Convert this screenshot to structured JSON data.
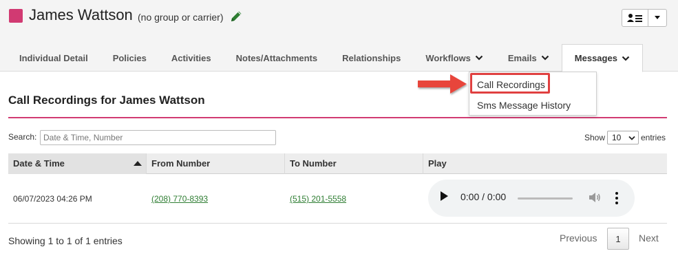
{
  "header": {
    "name": "James Wattson",
    "subtitle": "(no group or carrier)",
    "color_box": "#d13a72"
  },
  "tabs": [
    {
      "label": "Individual Detail",
      "dropdown": false
    },
    {
      "label": "Policies",
      "dropdown": false
    },
    {
      "label": "Activities",
      "dropdown": false
    },
    {
      "label": "Notes/Attachments",
      "dropdown": false
    },
    {
      "label": "Relationships",
      "dropdown": false
    },
    {
      "label": "Workflows",
      "dropdown": true
    },
    {
      "label": "Emails",
      "dropdown": true
    },
    {
      "label": "Messages",
      "dropdown": true,
      "active": true
    }
  ],
  "messages_menu": {
    "items": [
      "Call Recordings",
      "Sms Message History"
    ],
    "highlighted": "Call Recordings"
  },
  "section": {
    "title": "Call Recordings for James Wattson",
    "accent_color": "#d13a72"
  },
  "search": {
    "label": "Search:",
    "placeholder": "Date & Time, Number",
    "value": ""
  },
  "length": {
    "show_label": "Show",
    "value": "10",
    "entries_label": "entries"
  },
  "table": {
    "columns": [
      "Date & Time",
      "From Number",
      "To Number",
      "Play"
    ],
    "sorted_column": "Date & Time",
    "rows": [
      {
        "date_time": "06/07/2023 04:26 PM",
        "from": "(208) 770-8393",
        "to": "(515) 201-5558",
        "player_time": "0:00 / 0:00"
      }
    ]
  },
  "footer": {
    "info": "Showing 1 to 1 of 1 entries",
    "previous": "Previous",
    "page": "1",
    "next": "Next"
  },
  "icons": [
    "pencil-icon",
    "contact-list-icon",
    "caret-down-icon",
    "sort-asc-icon",
    "play-icon",
    "volume-icon",
    "more-vert-icon",
    "right-arrow-icon"
  ]
}
